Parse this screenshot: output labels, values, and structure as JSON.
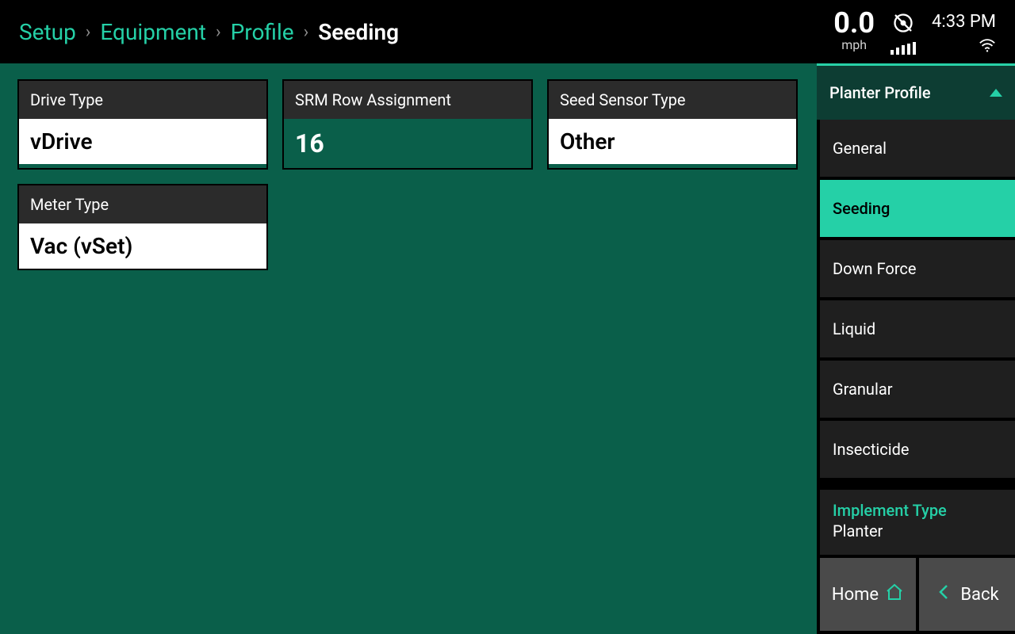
{
  "breadcrumb": {
    "items": [
      {
        "label": "Setup"
      },
      {
        "label": "Equipment"
      },
      {
        "label": "Profile"
      },
      {
        "label": "Seeding"
      }
    ]
  },
  "status": {
    "speed_value": "0.0",
    "speed_unit": "mph",
    "time": "4:33 PM"
  },
  "cards": {
    "drive_type": {
      "title": "Drive Type",
      "value": "vDrive"
    },
    "srm": {
      "title": "SRM Row Assignment",
      "value": "16"
    },
    "seed_sensor": {
      "title": "Seed Sensor Type",
      "value": "Other"
    },
    "meter_type": {
      "title": "Meter Type",
      "value": "Vac (vSet)"
    }
  },
  "sidebar": {
    "header": "Planter Profile",
    "items": [
      {
        "label": "General"
      },
      {
        "label": "Seeding"
      },
      {
        "label": "Down Force"
      },
      {
        "label": "Liquid"
      },
      {
        "label": "Granular"
      },
      {
        "label": "Insecticide"
      }
    ],
    "implement_label": "Implement Type",
    "implement_value": "Planter",
    "home_label": "Home",
    "back_label": "Back"
  }
}
